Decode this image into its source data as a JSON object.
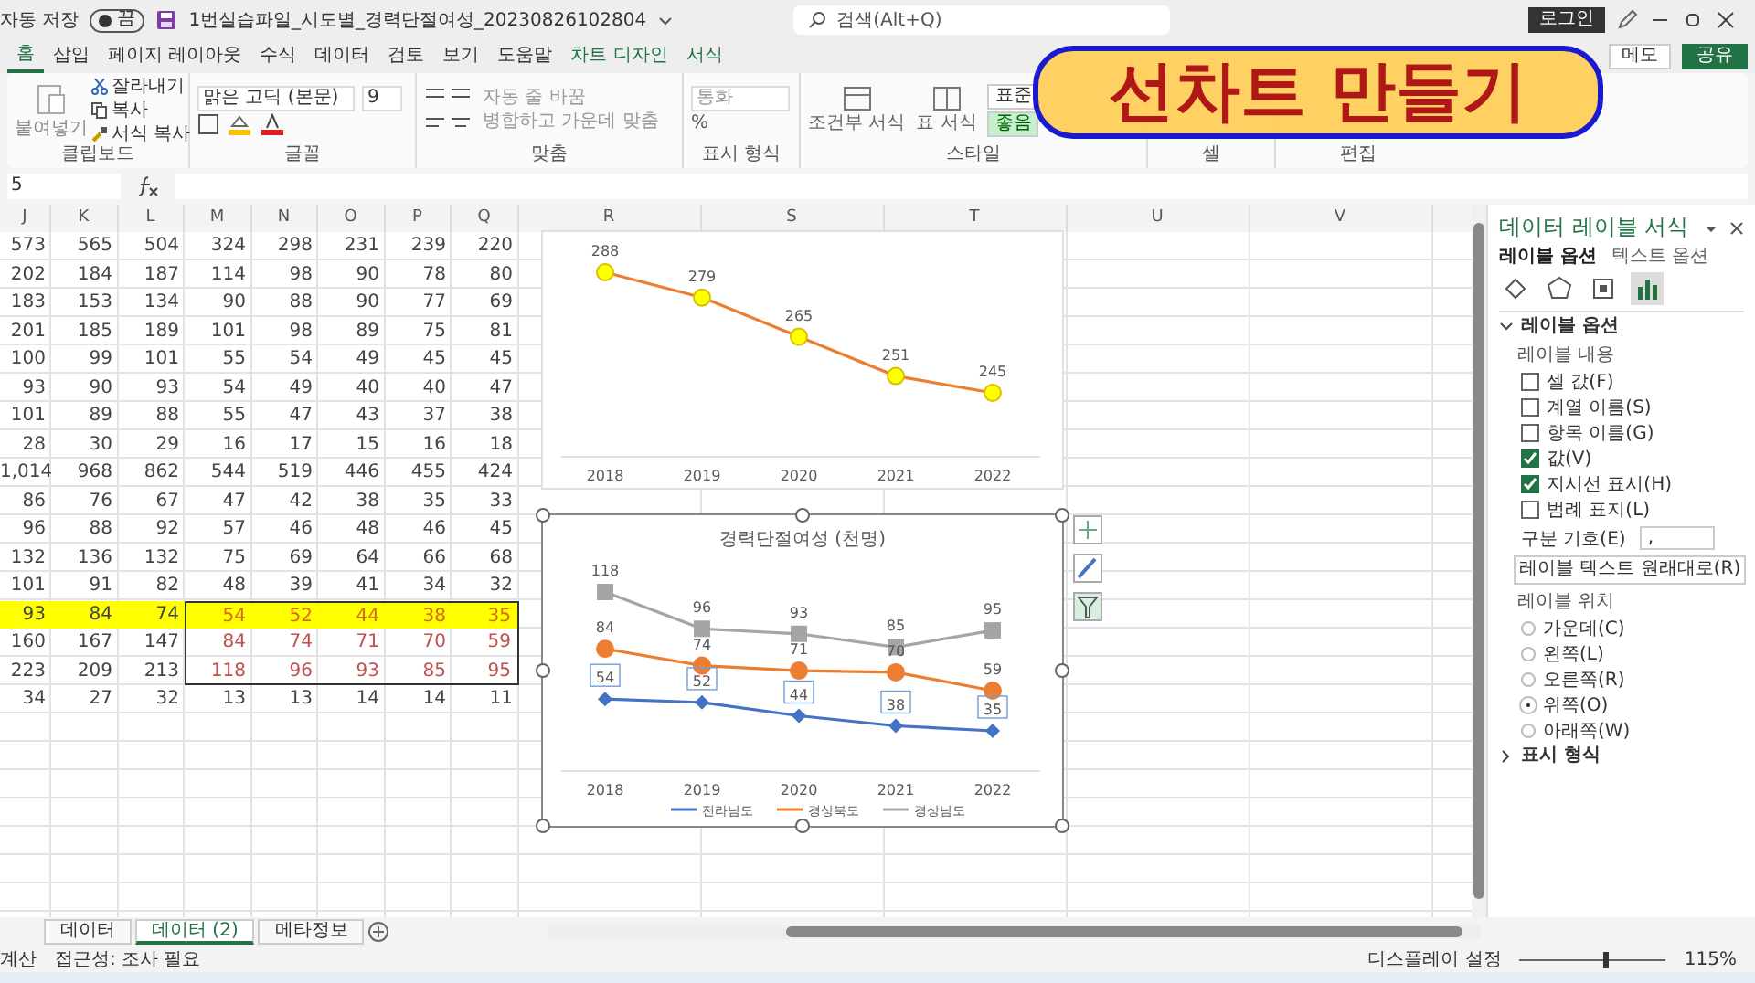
{
  "title_bar": {
    "autosave_label": "자동 저장",
    "autosave_on": false,
    "autosave_state": "끔",
    "filename": "1번실습파일_시도별_경력단절여성_20230826102804",
    "search_placeholder": "검색(Alt+Q)",
    "login": "로그인"
  },
  "menu_tabs": [
    {
      "label": "홈",
      "selected": true,
      "kind": "normal"
    },
    {
      "label": "삽입",
      "selected": false,
      "kind": "normal"
    },
    {
      "label": "페이지 레이아웃",
      "selected": false,
      "kind": "normal"
    },
    {
      "label": "수식",
      "selected": false,
      "kind": "normal"
    },
    {
      "label": "데이터",
      "selected": false,
      "kind": "normal"
    },
    {
      "label": "검토",
      "selected": false,
      "kind": "normal"
    },
    {
      "label": "보기",
      "selected": false,
      "kind": "normal"
    },
    {
      "label": "도움말",
      "selected": false,
      "kind": "normal"
    },
    {
      "label": "차트 디자인",
      "selected": false,
      "kind": "contextual"
    },
    {
      "label": "서식",
      "selected": false,
      "kind": "contextual"
    }
  ],
  "memo": "메모",
  "share": "공유",
  "ribbon": {
    "clipboard": {
      "paste": "붙여넣기",
      "cut": "잘라내기",
      "copy": "복사",
      "format_painter": "서식 복사",
      "label": "클립보드"
    },
    "font": {
      "name": "맑은 고딕 (본문)",
      "size": "9",
      "label": "글꼴"
    },
    "alignment": {
      "wrap": "자동 줄 바꿈",
      "merge": "병합하고 가운데 맞춤",
      "label": "맞춤"
    },
    "number": {
      "format": "통화",
      "percent": "%",
      "label": "표시 형식"
    },
    "styles": {
      "conditional": "조건부 서식",
      "table": "표 서식",
      "normal": "표준",
      "good": "좋음",
      "label": "스타일"
    },
    "cells_label": "셀",
    "editing_label": "편집"
  },
  "banner": {
    "text": "선차트 만들기"
  },
  "formula_bar": {
    "name_box": "5"
  },
  "sheet": {
    "columns": [
      "J",
      "K",
      "L",
      "M",
      "N",
      "O",
      "P",
      "Q",
      "R",
      "S",
      "T",
      "U",
      "V"
    ],
    "rows": [
      {
        "cells": [
          "573",
          "565",
          "504",
          "324",
          "298",
          "231",
          "239",
          "220"
        ],
        "highlighted": false,
        "chart_source": false
      },
      {
        "cells": [
          "202",
          "184",
          "187",
          "114",
          "98",
          "90",
          "78",
          "80"
        ],
        "highlighted": false,
        "chart_source": false
      },
      {
        "cells": [
          "183",
          "153",
          "134",
          "90",
          "88",
          "90",
          "77",
          "69"
        ],
        "highlighted": false,
        "chart_source": false
      },
      {
        "cells": [
          "201",
          "185",
          "189",
          "101",
          "98",
          "89",
          "75",
          "81"
        ],
        "highlighted": false,
        "chart_source": false
      },
      {
        "cells": [
          "100",
          "99",
          "101",
          "55",
          "54",
          "49",
          "45",
          "45"
        ],
        "highlighted": false,
        "chart_source": false
      },
      {
        "cells": [
          "93",
          "90",
          "93",
          "54",
          "49",
          "40",
          "40",
          "47"
        ],
        "highlighted": false,
        "chart_source": false
      },
      {
        "cells": [
          "101",
          "89",
          "88",
          "55",
          "47",
          "43",
          "37",
          "38"
        ],
        "highlighted": false,
        "chart_source": false
      },
      {
        "cells": [
          "28",
          "30",
          "29",
          "16",
          "17",
          "15",
          "16",
          "18"
        ],
        "highlighted": false,
        "chart_source": false
      },
      {
        "cells": [
          "1,014",
          "968",
          "862",
          "544",
          "519",
          "446",
          "455",
          "424"
        ],
        "highlighted": false,
        "chart_source": false
      },
      {
        "cells": [
          "86",
          "76",
          "67",
          "47",
          "42",
          "38",
          "35",
          "33"
        ],
        "highlighted": false,
        "chart_source": false
      },
      {
        "cells": [
          "96",
          "88",
          "92",
          "57",
          "46",
          "48",
          "46",
          "45"
        ],
        "highlighted": false,
        "chart_source": false
      },
      {
        "cells": [
          "132",
          "136",
          "132",
          "75",
          "69",
          "64",
          "66",
          "68"
        ],
        "highlighted": false,
        "chart_source": false
      },
      {
        "cells": [
          "101",
          "91",
          "82",
          "48",
          "39",
          "41",
          "34",
          "32"
        ],
        "highlighted": false,
        "chart_source": false
      },
      {
        "cells": [
          "93",
          "84",
          "74",
          "54",
          "52",
          "44",
          "38",
          "35"
        ],
        "highlighted": true,
        "chart_source": true
      },
      {
        "cells": [
          "160",
          "167",
          "147",
          "84",
          "74",
          "71",
          "70",
          "59"
        ],
        "highlighted": false,
        "chart_source": true
      },
      {
        "cells": [
          "223",
          "209",
          "213",
          "118",
          "96",
          "93",
          "85",
          "95"
        ],
        "highlighted": false,
        "chart_source": true
      },
      {
        "cells": [
          "34",
          "27",
          "32",
          "13",
          "13",
          "14",
          "14",
          "11"
        ],
        "highlighted": false,
        "chart_source": false
      }
    ]
  },
  "charts": [
    {
      "selected": false,
      "chart_data": {
        "type": "line",
        "categories": [
          "2018",
          "2019",
          "2020",
          "2021",
          "2022"
        ],
        "data_labels": true,
        "series": [
          {
            "color": "#ed7d31",
            "marker": "circle",
            "values": [
              288,
              279,
              265,
              251,
              245
            ]
          }
        ]
      }
    },
    {
      "selected": true,
      "chart_data": {
        "type": "line",
        "title": "경력단절여성 (천명)",
        "categories": [
          "2018",
          "2019",
          "2020",
          "2021",
          "2022"
        ],
        "data_labels": true,
        "legend": "bottom",
        "series": [
          {
            "name": "전라남도",
            "color": "#4472c4",
            "marker": "diamond",
            "values": [
              54,
              52,
              44,
              38,
              35
            ]
          },
          {
            "name": "경상북도",
            "color": "#ed7d31",
            "marker": "circle",
            "values": [
              84,
              74,
              71,
              70,
              59
            ]
          },
          {
            "name": "경상남도",
            "color": "#a5a5a5",
            "marker": "square",
            "values": [
              118,
              96,
              93,
              85,
              95
            ]
          }
        ]
      }
    }
  ],
  "panel": {
    "title": "데이터 레이블 서식",
    "tabs": [
      {
        "label": "레이블 옵션",
        "selected": true
      },
      {
        "label": "텍스트 옵션",
        "selected": false
      }
    ],
    "icon_tabs": [
      {
        "kind": "fill",
        "selected": false
      },
      {
        "kind": "shape",
        "selected": false
      },
      {
        "kind": "size",
        "selected": false
      },
      {
        "kind": "chart",
        "selected": true
      }
    ],
    "section": {
      "label": "레이블 옵션",
      "expanded": true
    },
    "contents_label": "레이블 내용",
    "checkboxes": [
      {
        "label": "셀 값(F)",
        "checked": false
      },
      {
        "label": "계열 이름(S)",
        "checked": false
      },
      {
        "label": "항목 이름(G)",
        "checked": false
      },
      {
        "label": "값(V)",
        "checked": true
      },
      {
        "label": "지시선 표시(H)",
        "checked": true
      },
      {
        "label": "범례 표지(L)",
        "checked": false
      }
    ],
    "separator_label": "구분 기호(E)",
    "separator_value": ",",
    "reset_button": "레이블 텍스트 원래대로(R)",
    "position_label": "레이블 위치",
    "positions": [
      {
        "label": "가운데(C)",
        "selected": false
      },
      {
        "label": "왼쪽(L)",
        "selected": false
      },
      {
        "label": "오른쪽(R)",
        "selected": false
      },
      {
        "label": "위쪽(O)",
        "selected": true
      },
      {
        "label": "아래쪽(W)",
        "selected": false
      }
    ],
    "number_section": {
      "label": "표시 형식",
      "expanded": false
    }
  },
  "sheet_tabs": [
    {
      "label": "데이터",
      "selected": false
    },
    {
      "label": "데이터 (2)",
      "selected": true
    },
    {
      "label": "메타정보",
      "selected": false
    }
  ],
  "status_bar": {
    "mode": "계산",
    "accessibility": "접근성: 조사 필요",
    "display_settings": "디스플레이 설정",
    "zoom": "115%",
    "zoom_slider": {
      "level": 0.58
    }
  }
}
